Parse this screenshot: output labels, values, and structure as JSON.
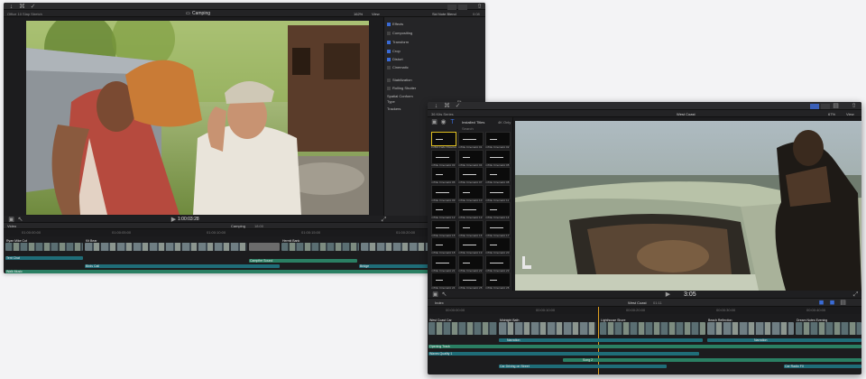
{
  "window1": {
    "breadcrumb": "Office 10 Slap Stretch",
    "viewer_title": "Camping",
    "zoom": "162%",
    "view_label": "View",
    "inspector_title": "Sid Note Blend",
    "inspector_timecode": "0:08",
    "inspector_rows": [
      {
        "label": "Effects",
        "checked": true
      },
      {
        "label": "Compositing",
        "checked": false
      },
      {
        "label": "Transform",
        "checked": true
      },
      {
        "label": "Crop",
        "checked": true
      },
      {
        "label": "Distort",
        "checked": true
      },
      {
        "label": "Cinematic",
        "checked": false
      },
      {
        "label": "Stabilization",
        "checked": false
      },
      {
        "label": "Rolling Shutter",
        "checked": false
      },
      {
        "label": "Spatial Conform",
        "checked": false
      },
      {
        "label": "Type",
        "checked": false
      },
      {
        "label": "Trackers",
        "checked": false
      }
    ],
    "type_value": "Fit",
    "timecode": "1:00:03:28",
    "timeline_index": "Video",
    "timeline_project": "Camping",
    "timeline_duration": "18:00",
    "ruler_marks": [
      "01:00:00:00",
      "01:00:05:00",
      "01:00:10:00",
      "01:00:15:00",
      "01:00:20:00"
    ],
    "clips": [
      "Ryan Mike Cut",
      "Kit Bear",
      "Hermit Bank"
    ],
    "audio_labels": [
      "Tent Chat",
      "Campfire Sound",
      "Birds Call",
      "Bridge"
    ],
    "bottom_label": "Walk Music"
  },
  "window2": {
    "library": "36 Kits Series",
    "browser_tab": "Installed Titles",
    "browser_filter": "4K Only",
    "search_placeholder": "Search",
    "viewer_title": "West Coast",
    "zoom": "67%",
    "view_label": "View",
    "timecode": "3:05",
    "timeline_index": "Index",
    "timeline_project": "West Coast",
    "timeline_duration": "01:11",
    "title_captions": [
      "LUMA Fade Dissolve",
      "mTitle Cinematic 01",
      "mTitle Cinematic 02",
      "mTitle Cinematic 03",
      "mTitle Cinematic 04",
      "mTitle Cinematic 05",
      "mTitle Cinematic 06",
      "mTitle Cinematic 07",
      "mTitle Cinematic 08",
      "mTitle Cinematic 09",
      "mTitle Cinematic 10",
      "mTitle Cinematic 11",
      "mTitle Cinematic 12",
      "mTitle Cinematic 13",
      "mTitle Cinematic 14",
      "mTitle Cinematic 15",
      "mTitle Cinematic 16",
      "mTitle Cinematic 17",
      "mTitle Cinematic 18",
      "mTitle Cinematic 19",
      "mTitle Cinematic 20",
      "mTitle Cinematic 21",
      "mTitle Cinematic 22",
      "mTitle Cinematic 23",
      "mTitle Cinematic 24",
      "mTitle Cinematic 25",
      "mTitle Cinematic 26"
    ],
    "ruler_marks": [
      "00:00:00:00",
      "00:00:10:00",
      "00:00:20:00",
      "00:00:30:00",
      "00:00:40:00"
    ],
    "clips": [
      "West Coast Car",
      "Midnight Bath",
      "Lighthouse Shore",
      "Beach Reflection",
      "Dream Notes Evening"
    ],
    "narration_labels": [
      "Narration",
      "Narration"
    ],
    "audio_labels": [
      "Opening Track",
      "Waves Quality 1",
      "Song 2",
      "Car Driving on Street",
      "Car Radio FX"
    ]
  },
  "colors": {
    "accent": "#3a6bd6",
    "playhead": "#e0a020",
    "audio": "#1f6d78"
  }
}
